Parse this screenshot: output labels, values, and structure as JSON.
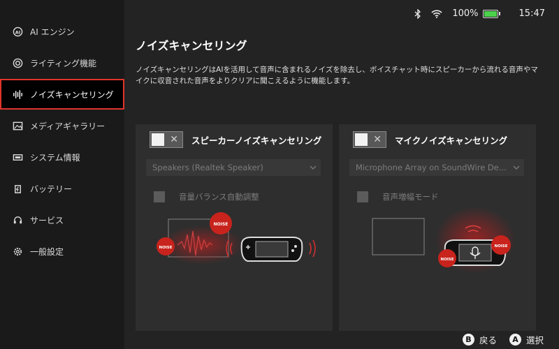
{
  "sidebar": {
    "items": [
      {
        "label": "AI エンジン",
        "icon": "ai-engine-icon"
      },
      {
        "label": "ライティング機能",
        "icon": "lighting-icon"
      },
      {
        "label": "ノイズキャンセリング",
        "icon": "sound-wave-icon",
        "active": true
      },
      {
        "label": "メディアギャラリー",
        "icon": "gallery-icon"
      },
      {
        "label": "システム情報",
        "icon": "system-info-icon"
      },
      {
        "label": "バッテリー",
        "icon": "battery-icon"
      },
      {
        "label": "サービス",
        "icon": "headset-icon"
      },
      {
        "label": "一般設定",
        "icon": "gear-icon"
      }
    ]
  },
  "status": {
    "battery_percent": "100%",
    "battery_level": 1.0,
    "time": "15:47"
  },
  "page": {
    "title": "ノイズキャンセリング",
    "description": "ノイズキャンセリングはAIを活用して音声に含まれるノイズを除去し、ボイスチャット時にスピーカーから流れる音声やマイクに収音された音声をよりクリアに聞こえるように機能します。"
  },
  "speaker": {
    "title": "スピーカーノイズキャンセリング",
    "device": "Speakers (Realtek Speaker)",
    "option_label": "音量バランス自動調整",
    "toggle_on": false,
    "noise_badge_1": "NOISE",
    "noise_badge_2": "NOISE"
  },
  "mic": {
    "title": "マイクノイズキャンセリング",
    "device": "Microphone Array on SoundWire De...",
    "option_label": "音声増幅モード",
    "toggle_on": false,
    "noise_badge_1": "NOISE",
    "noise_badge_2": "NOISE"
  },
  "footer": {
    "back_key": "B",
    "back_label": "戻る",
    "select_key": "A",
    "select_label": "選択"
  },
  "colors": {
    "accent": "#e0342b",
    "battery_fill": "#4cd14c"
  }
}
